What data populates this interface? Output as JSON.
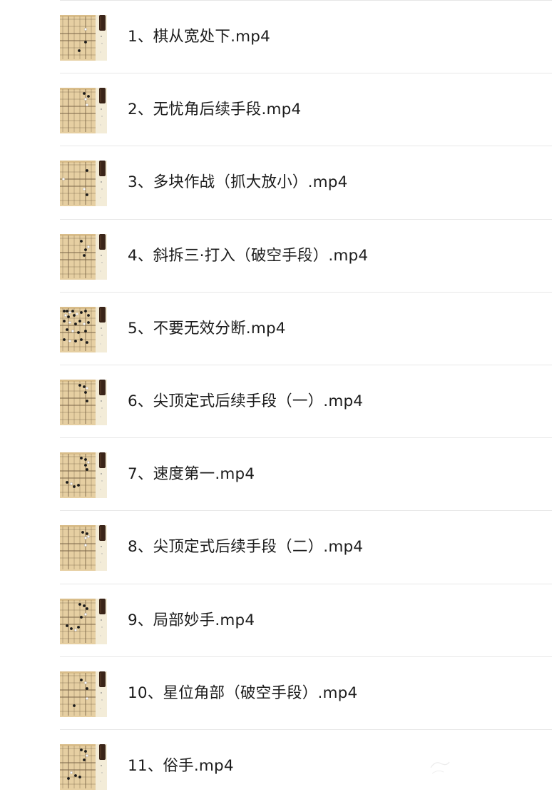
{
  "files": [
    {
      "name": "1、棋从宽处下.mp4",
      "thumb_icon": "go-board-thumbnail-icon"
    },
    {
      "name": "2、无忧角后续手段.mp4",
      "thumb_icon": "go-board-thumbnail-icon"
    },
    {
      "name": "3、多块作战（抓大放小）.mp4",
      "thumb_icon": "go-board-thumbnail-icon"
    },
    {
      "name": "4、斜拆三·打入（破空手段）.mp4",
      "thumb_icon": "go-board-thumbnail-icon"
    },
    {
      "name": "5、不要无效分断.mp4",
      "thumb_icon": "go-board-thumbnail-icon"
    },
    {
      "name": "6、尖顶定式后续手段（一）.mp4",
      "thumb_icon": "go-board-thumbnail-icon"
    },
    {
      "name": "7、速度第一.mp4",
      "thumb_icon": "go-board-thumbnail-icon"
    },
    {
      "name": "8、尖顶定式后续手段（二）.mp4",
      "thumb_icon": "go-board-thumbnail-icon"
    },
    {
      "name": "9、局部妙手.mp4",
      "thumb_icon": "go-board-thumbnail-icon"
    },
    {
      "name": "10、星位角部（破空手段）.mp4",
      "thumb_icon": "go-board-thumbnail-icon"
    },
    {
      "name": "11、俗手.mp4",
      "thumb_icon": "go-board-thumbnail-icon"
    }
  ],
  "colors": {
    "board": "#e6cfa2",
    "board_shade": "#d9bd8a",
    "grid": "#7a6548",
    "stone_black": "#1a1a1a",
    "stone_white": "#fafafa",
    "side_panel": "#f3ecd8",
    "side_dark": "#3a2418",
    "text": "#1c1c1c",
    "divider": "#e8e8e8"
  }
}
